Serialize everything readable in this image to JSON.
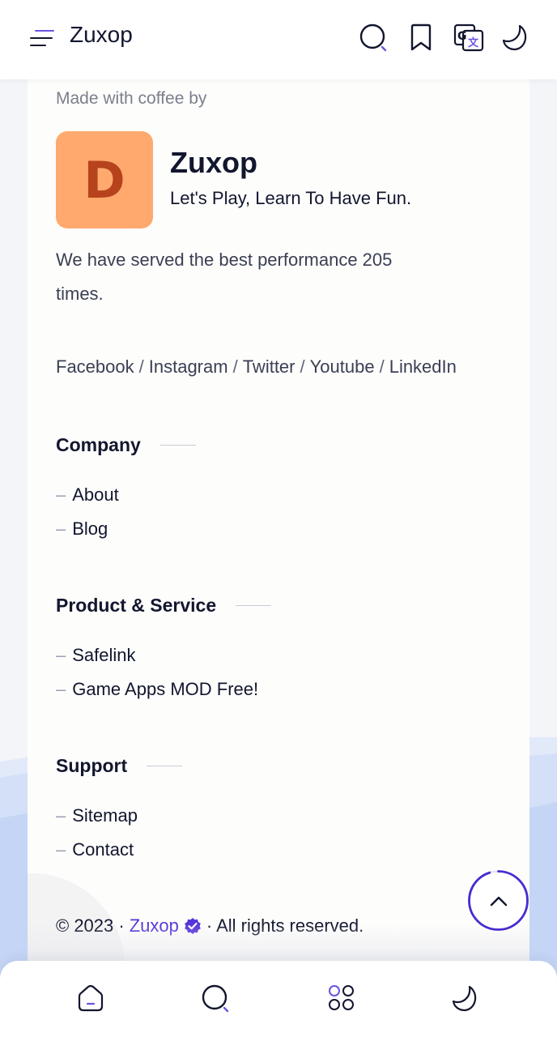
{
  "header": {
    "brand": "Zuxop",
    "icons": [
      "menu-icon",
      "search-icon",
      "bookmark-icon",
      "translate-icon",
      "moon-icon"
    ]
  },
  "profile": {
    "made_with": "Made with coffee by",
    "logo_letter": "D",
    "name": "Zuxop",
    "tagline": "Let's Play, Learn To Have Fun.",
    "served_text": "We have served the best performance 205 times.",
    "socials": [
      "Facebook",
      "Instagram",
      "Twitter",
      "Youtube",
      "LinkedIn"
    ],
    "separator": "/"
  },
  "sections": [
    {
      "title": "Company",
      "links": [
        "About",
        "Blog"
      ]
    },
    {
      "title": "Product & Service",
      "links": [
        "Safelink",
        "Game Apps MOD Free!"
      ]
    },
    {
      "title": "Support",
      "links": [
        "Sitemap",
        "Contact"
      ]
    }
  ],
  "footer": {
    "copyright": "© 2023 ·",
    "brand": "Zuxop",
    "rights": "· All rights reserved."
  },
  "bottom_nav": {
    "icons": [
      "home-icon",
      "search-icon",
      "apps-grid-icon",
      "moon-icon"
    ]
  },
  "colors": {
    "accent": "#5533d8",
    "logo_bg": "#ffa96e",
    "logo_text": "#b6431c",
    "text": "#12162e",
    "muted": "#7b7f8c",
    "wave": "#c9d8f6"
  }
}
